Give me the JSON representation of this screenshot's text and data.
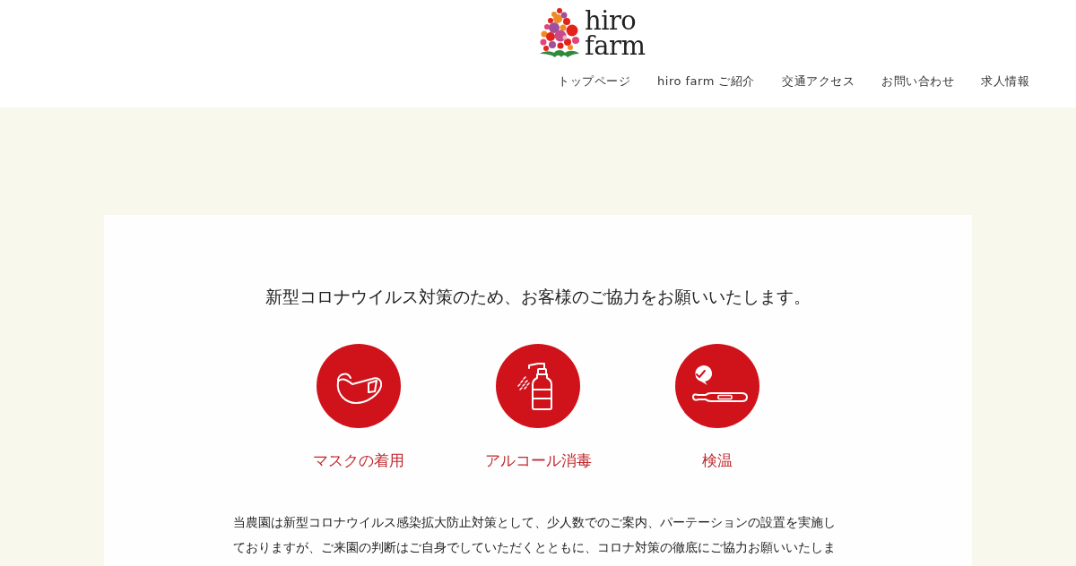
{
  "header": {
    "logo": {
      "line_1": "hiro",
      "line_2": "farm"
    },
    "nav": [
      {
        "label": "トップページ"
      },
      {
        "label": "hiro farm ご紹介"
      },
      {
        "label": "交通アクセス"
      },
      {
        "label": "お問い合わせ"
      },
      {
        "label": "求人情報"
      }
    ]
  },
  "notice": {
    "heading": "新型コロナウイルス対策のため、お客様のご協力をお願いいたします。",
    "measures": [
      {
        "kind": "mask",
        "label": "マスクの着用"
      },
      {
        "kind": "sanitizer",
        "label": "アルコール消毒"
      },
      {
        "kind": "thermometer",
        "label": "検温"
      }
    ],
    "paragraph_lines": [
      "当農園は新型コロナウイルス感染拡大防止対策として、少人数でのご案内、パーテーションの設置を実施し",
      "ておりますが、ご来園の判断はご自身でしていただくとともに、コロナ対策の徹底にご協力お願いいたしま"
    ]
  }
}
